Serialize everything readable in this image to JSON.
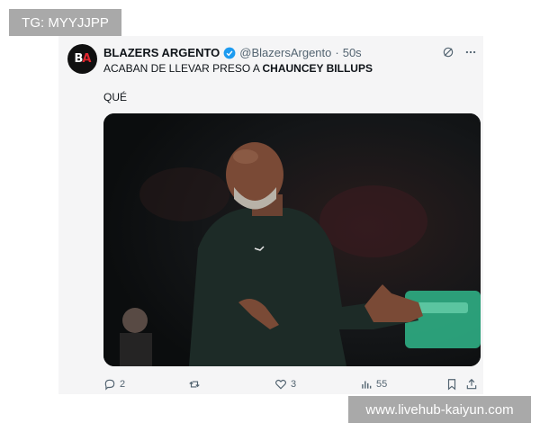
{
  "watermark_top": "TG: MYYJJPP",
  "watermark_bottom": "www.livehub-kaiyun.com",
  "tweet": {
    "author_name": "BLAZERS ARGENTO",
    "handle": "@BlazersArgento",
    "separator": "·",
    "time": "50s",
    "avatar_text_b": "B",
    "avatar_text_a": "A",
    "text_prefix": "ACABAN DE LLEVAR PRESO A ",
    "text_bold": "CHAUNCEY BILLUPS",
    "text_second": "QUÉ",
    "replies": "2",
    "likes": "3",
    "views": "55"
  },
  "colors": {
    "verified": "#1d9bf0",
    "avatar_bg": "#101010",
    "avatar_accent": "#e0262e"
  },
  "icons": [
    "grok-icon",
    "more-icon",
    "reply-icon",
    "retweet-icon",
    "like-icon",
    "views-icon",
    "bookmark-icon",
    "share-icon",
    "verified-badge-icon"
  ]
}
